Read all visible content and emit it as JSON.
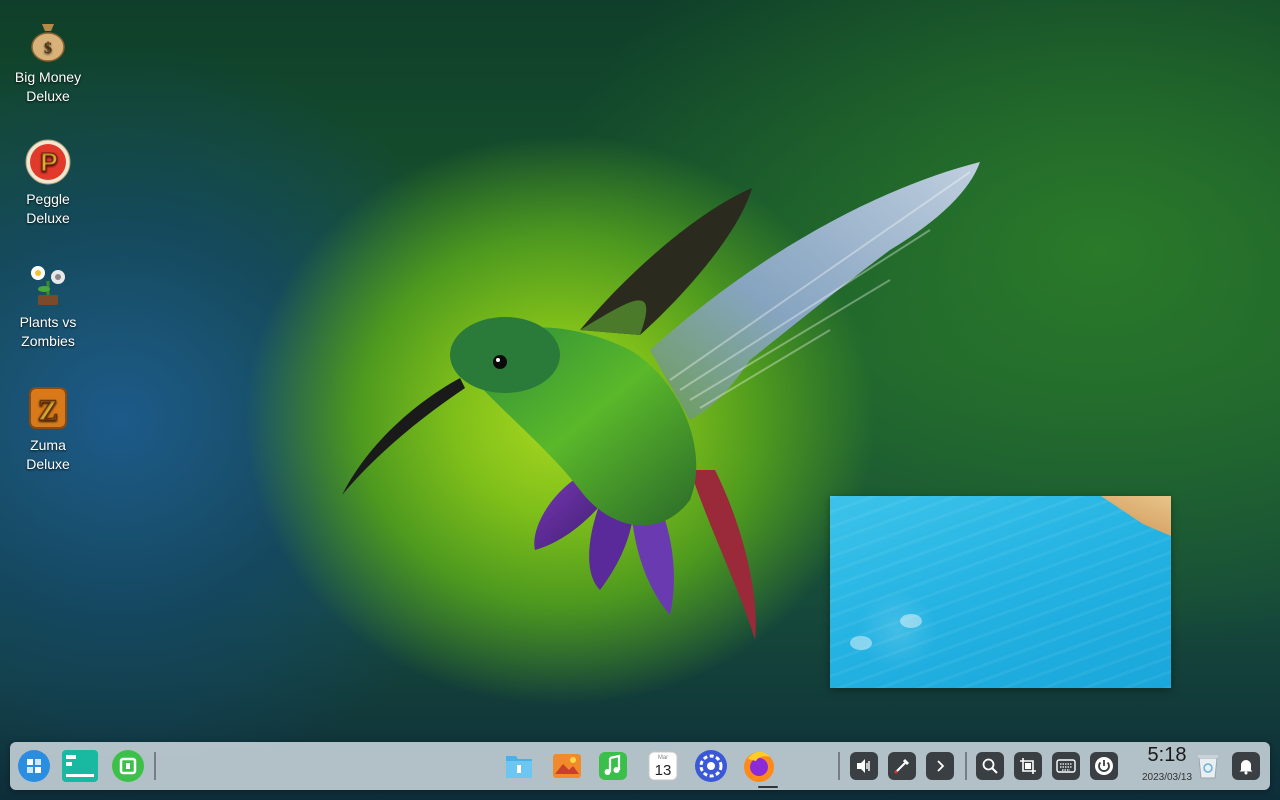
{
  "desktop": {
    "icons": [
      {
        "label_line1": "Big Money",
        "label_line2": "Deluxe",
        "icon": "money-bag-icon"
      },
      {
        "label_line1": "Peggle",
        "label_line2": "Deluxe",
        "icon": "peggle-icon"
      },
      {
        "label_line1": "Plants vs",
        "label_line2": "Zombies",
        "icon": "plants-vs-zombies-icon"
      },
      {
        "label_line1": "Zuma",
        "label_line2": "Deluxe",
        "icon": "zuma-icon"
      }
    ]
  },
  "taskbar": {
    "left_apps": [
      "launcher-icon",
      "multitask-view-icon",
      "app-store-icon"
    ],
    "center_apps": [
      "file-manager-icon",
      "image-viewer-icon",
      "music-icon",
      "calendar-icon",
      "settings-icon",
      "firefox-icon"
    ],
    "calendar_day": "13",
    "calendar_month": "Mar",
    "tray": [
      "volume-icon",
      "color-picker-icon",
      "expand-arrow-icon",
      "search-icon",
      "screenshot-icon",
      "keyboard-icon",
      "power-icon"
    ],
    "clock": {
      "time": "5:18",
      "date": "2023/03/13"
    },
    "right_icons": [
      "trash-icon",
      "notification-bell-icon"
    ]
  },
  "colors": {
    "wallpaper_center": "#a8d820",
    "taskbar_bg": "#d7e1e6",
    "water": "#23b2e2"
  }
}
